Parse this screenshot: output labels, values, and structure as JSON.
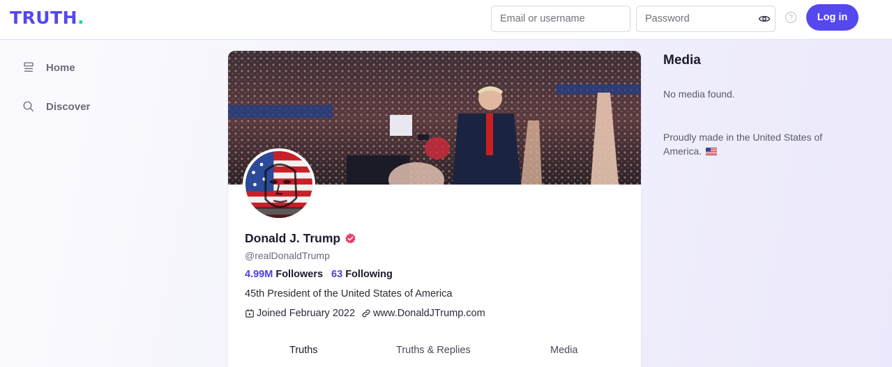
{
  "header": {
    "logo_text": "TRUTH",
    "logo_dot": ".",
    "email_placeholder": "Email or username",
    "password_placeholder": "Password",
    "login_label": "Log in"
  },
  "sidebar": {
    "items": [
      {
        "label": "Home",
        "icon": "home-icon"
      },
      {
        "label": "Discover",
        "icon": "search-icon"
      }
    ]
  },
  "profile": {
    "name": "Donald J. Trump",
    "handle": "@realDonaldTrump",
    "followers_count": "4.99M",
    "followers_label": "Followers",
    "following_count": "63",
    "following_label": "Following",
    "bio": "45th President of the United States of America",
    "joined": "Joined February 2022",
    "website": "www.DonaldJTrump.com"
  },
  "tabs": [
    {
      "label": "Truths",
      "active": true
    },
    {
      "label": "Truths & Replies",
      "active": false
    },
    {
      "label": "Media",
      "active": false
    }
  ],
  "right_panel": {
    "title": "Media",
    "empty_text": "No media found.",
    "footer": "Proudly made in the United States of America."
  },
  "colors": {
    "accent": "#5448ee",
    "logo_dot": "#10d6ad",
    "verified": "#e8416a",
    "link_count": "#4a40e0"
  }
}
